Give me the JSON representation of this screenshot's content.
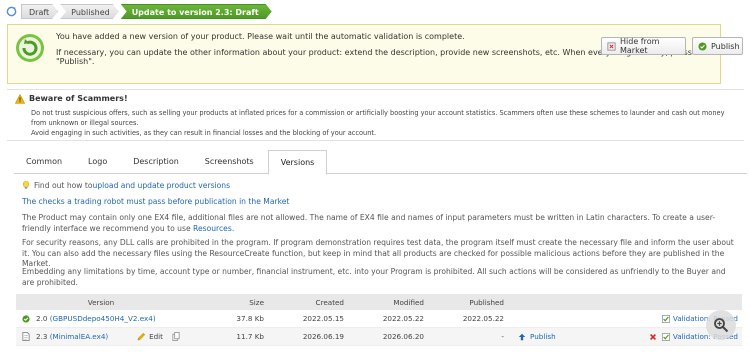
{
  "breadcrumb": {
    "steps": [
      "Draft",
      "Published",
      "Update to version 2.3: Draft"
    ]
  },
  "notice": {
    "line1": "You have added a new version of your product. Please wait until the automatic validation is complete.",
    "line2": "If necessary, you can update the other information about your product: extend the description, provide new screenshots, etc. When everything is ready, press \"Publish\".",
    "hide_button": "Hide from Market",
    "publish_button": "Publish"
  },
  "scam": {
    "title": "Beware of Scammers!",
    "text1": "Do not trust suspicious offers, such as selling your products at inflated prices for a commission or artificially boosting your account statistics. Scammers often use these schemes to launder and cash out money from unknown or illegal sources.",
    "text2": "Avoid engaging in such activities, as they can result in financial losses and the blocking of your account."
  },
  "tabs": [
    "Common",
    "Logo",
    "Description",
    "Screenshots",
    "Versions"
  ],
  "active_tab": "Versions",
  "content": {
    "find_prefix": "Find out how to ",
    "find_link": "upload and update product versions",
    "checks_link": "The checks a trading robot must pass before publication in the Market",
    "p1_text": "The Product may contain only one EX4 file, additional files are not allowed. The name of EX4 file and names of input parameters must be written in Latin characters. To create a user-friendly interface we recommend you to use ",
    "p1_link": "Resources",
    "p1_end": ".",
    "p2": "For security reasons, any DLL calls are prohibited in the program. If program demonstration requires test data, the program itself must create the necessary file and inform the user about it. You can also add the necessary files using the ResourceCreate function, but keep in mind that all products are checked for possible malicious actions before they are published in the Market.",
    "p3": "Embedding any limitations by time, account type or number, financial instrument, etc. into your Program is prohibited. All such actions will be considered as unfriendly to the Buyer and are prohibited."
  },
  "table": {
    "headers": {
      "version": "Version",
      "size": "Size",
      "created": "Created",
      "modified": "Modified",
      "published": "Published"
    },
    "rows": [
      {
        "version": "2.0",
        "file": "(GBPUSDdepo450H4_V2.ex4)",
        "size": "37.8 Kb",
        "created": "2022.05.15",
        "modified": "2022.05.22",
        "published": "2022.05.22",
        "publish_action": "",
        "validation": "Validation: Passed"
      },
      {
        "version": "2.3",
        "file": "(MinimalEA.ex4)",
        "edit": "Edit",
        "size": "11.7 Kb",
        "created": "2026.06.19",
        "modified": "2026.06.20",
        "published": "-",
        "publish_action": "Publish",
        "validation": "Validation: Passed"
      }
    ]
  },
  "colors": {
    "accent_green": "#4e9a24",
    "link_blue": "#1f66b5",
    "notice_bg": "#fdfce8"
  }
}
